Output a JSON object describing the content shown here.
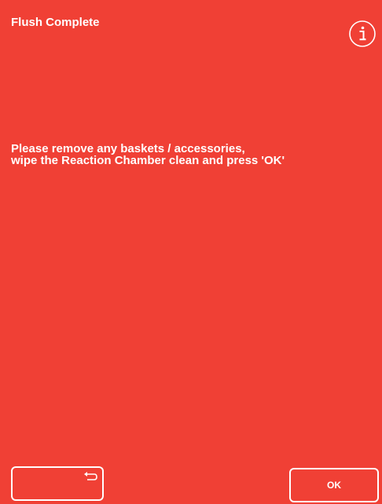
{
  "header": {
    "title": "Flush Complete",
    "info_icon": "info-circle-icon"
  },
  "message": {
    "line1": "Please remove any baskets / accessories,",
    "line2": "wipe the Reaction Chamber clean and press 'OK'"
  },
  "buttons": {
    "back_icon": "return-arrow-icon",
    "ok_label": "OK"
  },
  "colors": {
    "background": "#f04035",
    "foreground": "#ffffff"
  }
}
